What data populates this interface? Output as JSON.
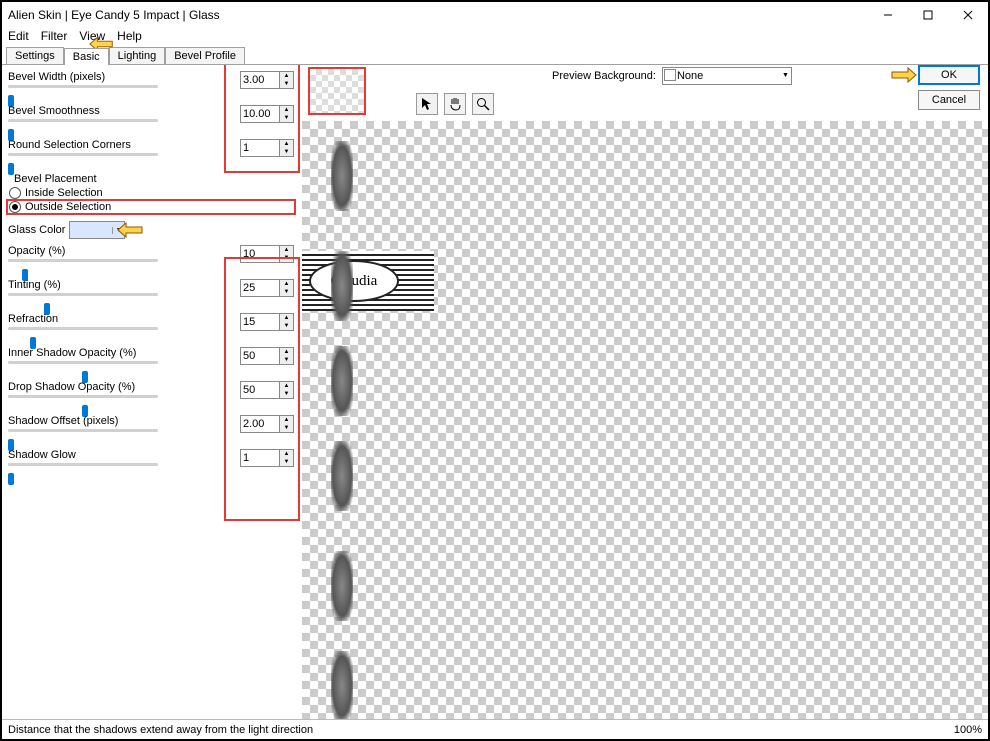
{
  "window": {
    "title": "Alien Skin | Eye Candy 5 Impact | Glass"
  },
  "menu": {
    "edit": "Edit",
    "filter": "Filter",
    "view": "View",
    "help": "Help"
  },
  "tabs": {
    "settings": "Settings",
    "basic": "Basic",
    "lighting": "Lighting",
    "bevel_profile": "Bevel Profile"
  },
  "params": {
    "bevel_width": {
      "label": "Bevel Width (pixels)",
      "value": "3.00"
    },
    "bevel_smoothness": {
      "label": "Bevel Smoothness",
      "value": "10.00"
    },
    "round_corners": {
      "label": "Round Selection Corners",
      "value": "1"
    },
    "bevel_placement": {
      "label": "Bevel Placement",
      "inside": "Inside Selection",
      "outside": "Outside Selection"
    },
    "glass_color": {
      "label": "Glass Color"
    },
    "opacity": {
      "label": "Opacity (%)",
      "value": "10"
    },
    "tinting": {
      "label": "Tinting (%)",
      "value": "25"
    },
    "refraction": {
      "label": "Refraction",
      "value": "15"
    },
    "inner_shadow": {
      "label": "Inner Shadow Opacity (%)",
      "value": "50"
    },
    "drop_shadow": {
      "label": "Drop Shadow Opacity (%)",
      "value": "50"
    },
    "shadow_offset": {
      "label": "Shadow Offset (pixels)",
      "value": "2.00"
    },
    "shadow_glow": {
      "label": "Shadow Glow",
      "value": "1"
    }
  },
  "preview": {
    "bg_label": "Preview Background:",
    "bg_value": "None"
  },
  "buttons": {
    "ok": "OK",
    "cancel": "Cancel"
  },
  "status": {
    "hint": "Distance that the shadows extend away from the light direction",
    "zoom": "100%"
  },
  "stamp": "Claudia"
}
